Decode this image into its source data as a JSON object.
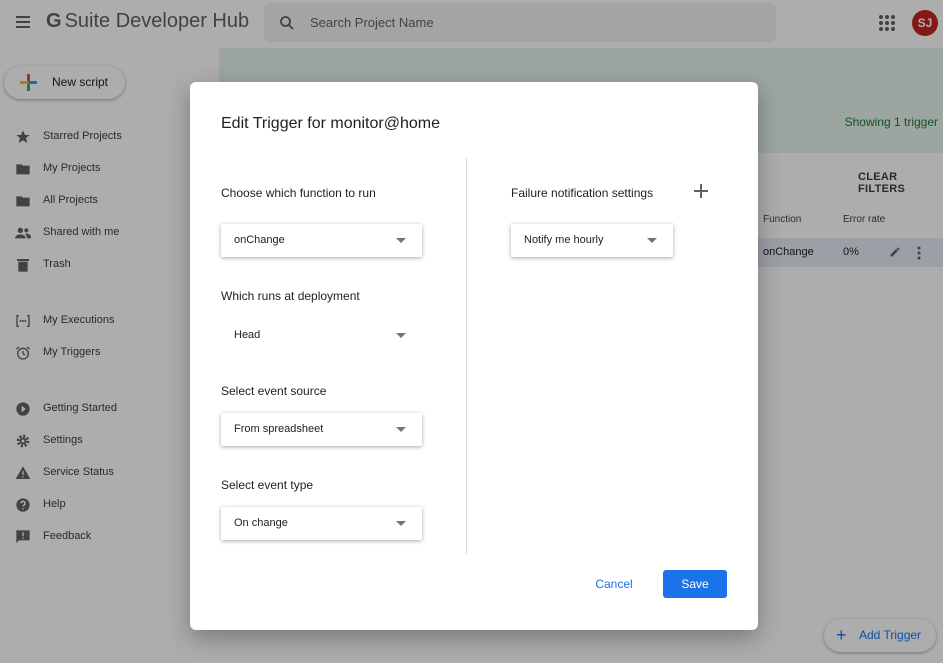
{
  "header": {
    "logo_g": "G",
    "title": "Suite Developer Hub",
    "search_placeholder": "Search Project Name",
    "avatar_initials": "SJ"
  },
  "new_script_label": "New script",
  "sidebar": {
    "items": [
      {
        "label": "Starred Projects",
        "icon": "star-icon"
      },
      {
        "label": "My Projects",
        "icon": "folder-icon"
      },
      {
        "label": "All Projects",
        "icon": "folder-icon"
      },
      {
        "label": "Shared with me",
        "icon": "people-icon"
      },
      {
        "label": "Trash",
        "icon": "trash-icon"
      },
      {
        "label": "My Executions",
        "icon": "executions-icon"
      },
      {
        "label": "My Triggers",
        "icon": "alarm-icon"
      },
      {
        "label": "Getting Started",
        "icon": "play-icon"
      },
      {
        "label": "Settings",
        "icon": "gear-icon"
      },
      {
        "label": "Service Status",
        "icon": "warning-icon"
      },
      {
        "label": "Help",
        "icon": "help-icon"
      },
      {
        "label": "Feedback",
        "icon": "feedback-icon"
      }
    ]
  },
  "triggers_panel": {
    "showing": "Showing 1 trigger",
    "clear_filters": "CLEAR FILTERS",
    "columns": {
      "function": "Function",
      "error_rate": "Error rate"
    },
    "row": {
      "function": "onChange",
      "error_rate": "0%"
    },
    "add_trigger": "Add Trigger"
  },
  "dialog": {
    "title": "Edit Trigger for monitor@home",
    "function_label": "Choose which function to run",
    "function_value": "onChange",
    "deployment_label": "Which runs at deployment",
    "deployment_value": "Head",
    "source_label": "Select event source",
    "source_value": "From spreadsheet",
    "type_label": "Select event type",
    "type_value": "On change",
    "failure_label": "Failure notification settings",
    "failure_value": "Notify me hourly",
    "cancel": "Cancel",
    "save": "Save"
  },
  "colors": {
    "accent": "#1a73e8",
    "banner_bg": "#e6f4ea",
    "banner_text": "#188038",
    "avatar_bg": "#c5221f"
  }
}
